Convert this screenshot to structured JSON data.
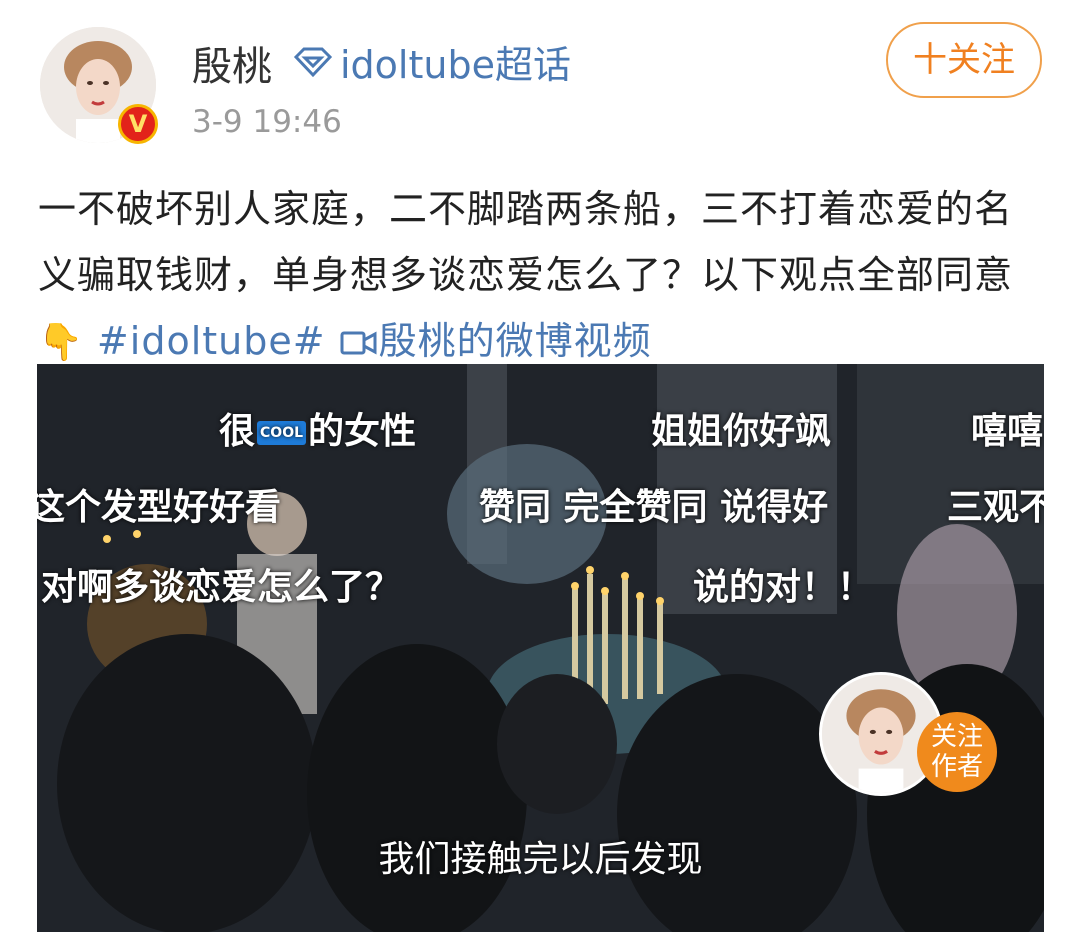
{
  "post": {
    "author_name": "殷桃",
    "topic_label": "idoltube超话",
    "time": "3-9 19:46",
    "follow_button": "十关注",
    "text_plain": "一不破坏别人家庭，二不脚踏两条船，三不打着恋爱的名义骗取钱财，单身想多谈恋爱怎么了？以下观点全部同意",
    "pointing_emoji": "👇",
    "hashtag": "#idoltube#",
    "video_link": "殷桃的微博视频"
  },
  "video": {
    "danmu": {
      "row1_a_prefix": "很",
      "row1_a_badge": "COOL",
      "row1_a_suffix": "的女性",
      "row1_b": "姐姐你好飒",
      "row1_c": "嘻嘻",
      "row2_a": "这个发型好好看",
      "row2_b": "赞同 完全赞同  说得好",
      "row2_c": "三观不",
      "row3_a": "对啊多谈恋爱怎么了？",
      "row3_b": "说的对！！"
    },
    "subtitle": "我们接触完以后发现",
    "follow_author_line1": "关注",
    "follow_author_line2": "作者"
  },
  "colors": {
    "link_blue": "#4b79b3",
    "follow_orange": "#f08020",
    "badge_red": "#e2231a"
  },
  "icons": [
    "diamond-topic-icon",
    "verified-v-icon",
    "video-camera-icon",
    "pointing-down-hand-icon"
  ]
}
